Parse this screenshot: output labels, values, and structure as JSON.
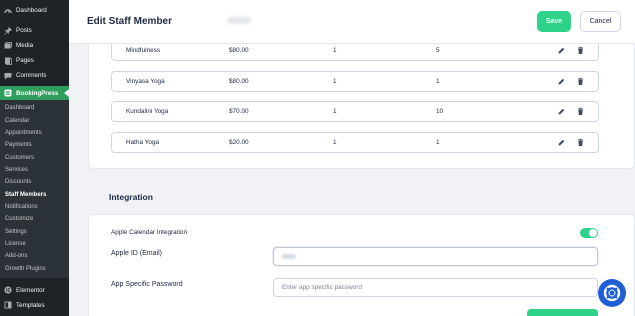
{
  "sidebar": {
    "top_items": [
      {
        "label": "Dashboard",
        "icon": "dashboard-icon"
      },
      {
        "label": "Posts",
        "icon": "pin-icon"
      },
      {
        "label": "Media",
        "icon": "media-icon"
      },
      {
        "label": "Pages",
        "icon": "pages-icon"
      },
      {
        "label": "Comments",
        "icon": "comment-icon"
      }
    ],
    "active": {
      "label": "BookingPress",
      "icon": "bookingpress-icon"
    },
    "sub_items": [
      "Dashboard",
      "Calendar",
      "Appointments",
      "Payments",
      "Customers",
      "Services",
      "Discounts",
      "Staff Members",
      "Notifications",
      "Customize",
      "Settings",
      "License",
      "Add-ons",
      "Growth Plugins"
    ],
    "current_sub": "Staff Members",
    "bottom_items": [
      {
        "label": "Elementor",
        "icon": "elementor-icon"
      },
      {
        "label": "Templates",
        "icon": "templates-icon"
      }
    ]
  },
  "header": {
    "title": "Edit Staff Member",
    "save_label": "Save",
    "cancel_label": "Cancel"
  },
  "services": [
    {
      "name": "Mindfulness",
      "price": "$80.00",
      "min_capacity": "1",
      "max_capacity": "5"
    },
    {
      "name": "Vinyasa Yoga",
      "price": "$80.00",
      "min_capacity": "1",
      "max_capacity": "1"
    },
    {
      "name": "Kundalini Yoga",
      "price": "$70.00",
      "min_capacity": "1",
      "max_capacity": "10"
    },
    {
      "name": "Hatha Yoga",
      "price": "$20.00",
      "min_capacity": "1",
      "max_capacity": "1"
    }
  ],
  "integration": {
    "title": "Integration",
    "apple_calendar_label": "Apple Calendar Integration",
    "apple_calendar_enabled": true,
    "apple_id_label": "Apple ID (Email)",
    "app_password_label": "App Specific Password",
    "app_password_placeholder": "Enter app specific password"
  },
  "colors": {
    "accent": "#2ed389",
    "wp_active": "#2e9e5c",
    "help": "#1f5fd6"
  }
}
